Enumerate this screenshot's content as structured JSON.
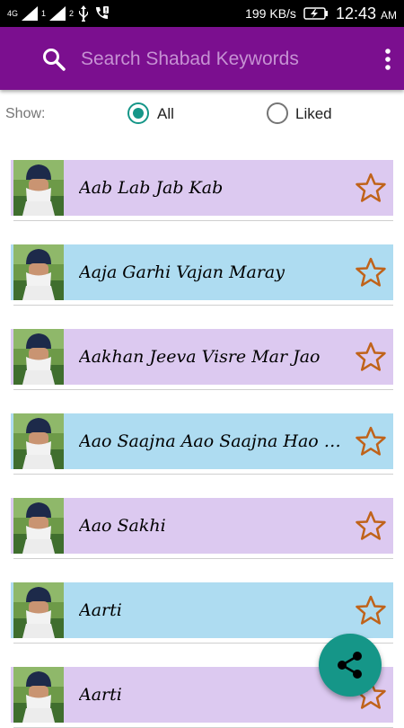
{
  "status_bar": {
    "network": "4G",
    "sim1": "1",
    "sim2": "2",
    "speed": "199 KB/s",
    "time": "12:43",
    "ampm": "AM"
  },
  "search": {
    "placeholder": "Search Shabad Keywords"
  },
  "filter": {
    "label": "Show:",
    "options": [
      "All",
      "Liked"
    ],
    "selected": "All"
  },
  "shabads": [
    {
      "title": "Aab Lab Jab Kab",
      "color": "#dcc9f0"
    },
    {
      "title": "Aaja Garhi Vajan Maray",
      "color": "#aedcf1"
    },
    {
      "title": "Aakhan Jeeva Visre Mar Jao",
      "color": "#dcc9f0"
    },
    {
      "title": "Aao Saajna Aao Saajna Hao Dekha Darshan Tera",
      "color": "#aedcf1"
    },
    {
      "title": "Aao Sakhi",
      "color": "#dcc9f0"
    },
    {
      "title": "Aarti",
      "color": "#aedcf1"
    },
    {
      "title": "Aarti",
      "color": "#dcc9f0"
    }
  ],
  "icons": {
    "search": "search-icon",
    "menu": "more-vert-icon",
    "star": "star-outline-icon",
    "share": "share-icon"
  },
  "colors": {
    "app_bar": "#7b0f8f",
    "accent": "#159688",
    "star": "#c0631a"
  }
}
